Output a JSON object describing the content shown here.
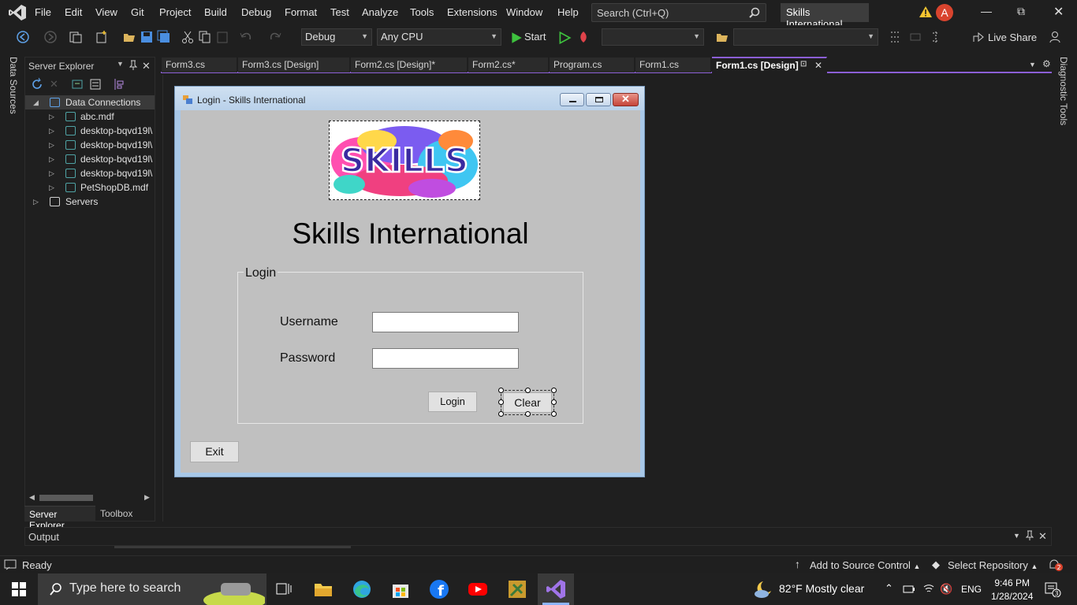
{
  "menu": {
    "items": [
      "File",
      "Edit",
      "View",
      "Git",
      "Project",
      "Build",
      "Debug",
      "Format",
      "Test",
      "Analyze",
      "Tools",
      "Extensions",
      "Window",
      "Help"
    ],
    "search_placeholder": "Search (Ctrl+Q)",
    "solution_name": "Skills International",
    "avatar_initial": "A"
  },
  "toolbar": {
    "configuration": "Debug",
    "platform": "Any CPU",
    "start_label": "Start",
    "live_share": "Live Share"
  },
  "side_labels": {
    "left": "Data Sources",
    "right": "Diagnostic Tools"
  },
  "server_explorer": {
    "title": "Server Explorer",
    "tree": [
      {
        "label": "Data Connections",
        "level": 1,
        "expanded": true
      },
      {
        "label": "abc.mdf",
        "level": 2
      },
      {
        "label": "desktop-bqvd19l\\",
        "level": 2
      },
      {
        "label": "desktop-bqvd19l\\",
        "level": 2
      },
      {
        "label": "desktop-bqvd19l\\",
        "level": 2
      },
      {
        "label": "desktop-bqvd19l\\",
        "level": 2
      },
      {
        "label": "PetShopDB.mdf",
        "level": 2
      },
      {
        "label": "Servers",
        "level": 1
      }
    ],
    "tabs": [
      "Server Explorer",
      "Toolbox"
    ]
  },
  "editor": {
    "tabs": [
      "Form3.cs",
      "Form3.cs [Design]",
      "Form2.cs [Design]*",
      "Form2.cs*",
      "Program.cs",
      "Form1.cs",
      "Form1.cs [Design]"
    ],
    "active_tab": "Form1.cs [Design]"
  },
  "form": {
    "window_title": "Login - Skills International",
    "logo_text": "SKILLS",
    "heading": "Skills International",
    "group_title": "Login",
    "username_label": "Username",
    "password_label": "Password",
    "username_value": "",
    "password_value": "",
    "login_button": "Login",
    "clear_button": "Clear",
    "exit_button": "Exit"
  },
  "output": {
    "title": "Output"
  },
  "status": {
    "ready": "Ready",
    "add_source": "Add to Source Control",
    "select_repo": "Select Repository",
    "notifications": "2"
  },
  "taskbar": {
    "search_placeholder": "Type here to search",
    "weather": "82°F  Mostly clear",
    "lang": "ENG",
    "time": "9:46 PM",
    "date": "1/28/2024",
    "notification_count": "3"
  },
  "colors": {
    "vs_accent": "#8c5fd6",
    "form_background": "#c0c0c0",
    "start_green": "#3ec13e"
  }
}
